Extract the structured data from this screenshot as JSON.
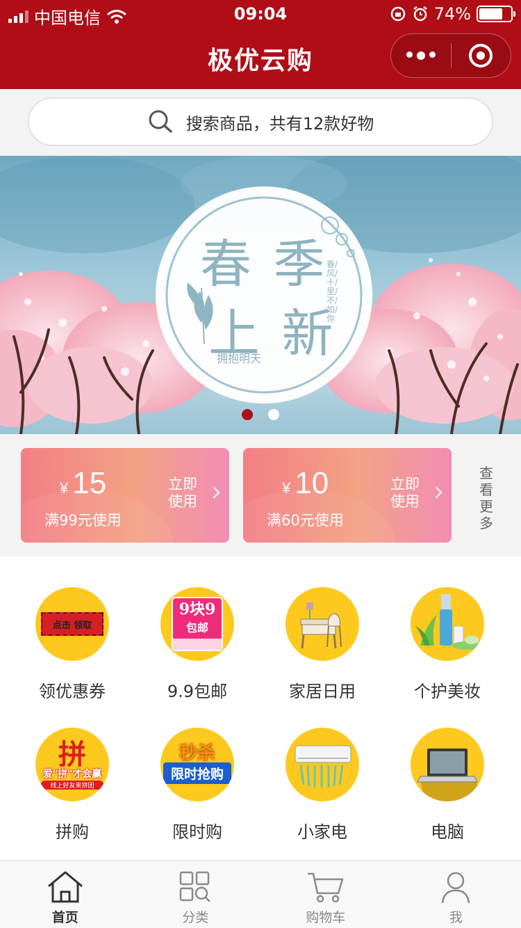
{
  "status_bar": {
    "carrier": "中国电信",
    "time": "09:04",
    "battery": "74%"
  },
  "navbar": {
    "title": "极优云购"
  },
  "search": {
    "placeholder": "搜索商品，共有12款好物"
  },
  "banner": {
    "line1": "春 季",
    "line2": "上 新",
    "tagline": "拥抱明天",
    "side_text": "春/风/十/里/不/如/你",
    "active_slide": 1,
    "slide_count": 2
  },
  "coupons": [
    {
      "currency": "¥",
      "amount": "15",
      "condition": "满99元使用",
      "action": "立即使用"
    },
    {
      "currency": "¥",
      "amount": "10",
      "condition": "满60元使用",
      "action": "立即使用"
    }
  ],
  "coupons_more": "查看更多",
  "categories": [
    {
      "label": "领优惠券",
      "icon": "coupon-ticket-icon",
      "badge": "点击 领取"
    },
    {
      "label": "9.9包邮",
      "icon": "free-shipping-icon",
      "badge_top": "9块9",
      "badge_bottom": "包邮"
    },
    {
      "label": "家居日用",
      "icon": "furniture-icon"
    },
    {
      "label": "个护美妆",
      "icon": "cosmetics-icon"
    },
    {
      "label": "拼购",
      "icon": "group-buy-icon",
      "badge_top": "拼",
      "badge_mid": "爱\"拼\"才会赢",
      "badge_bottom": "线上好友来拼团"
    },
    {
      "label": "限时购",
      "icon": "flash-sale-icon",
      "badge_top": "秒杀",
      "badge_bottom": "限时抢购"
    },
    {
      "label": "小家电",
      "icon": "air-conditioner-icon"
    },
    {
      "label": "电脑",
      "icon": "laptop-icon"
    }
  ],
  "tabbar": [
    {
      "label": "首页",
      "icon": "home-icon",
      "active": true
    },
    {
      "label": "分类",
      "icon": "category-icon",
      "active": false
    },
    {
      "label": "购物车",
      "icon": "cart-icon",
      "active": false
    },
    {
      "label": "我",
      "icon": "user-icon",
      "active": false
    }
  ],
  "colors": {
    "brand": "#b00d17",
    "icon_bg": "#fec91f",
    "coupon_start": "#f37e86",
    "coupon_end": "#f28db5"
  }
}
